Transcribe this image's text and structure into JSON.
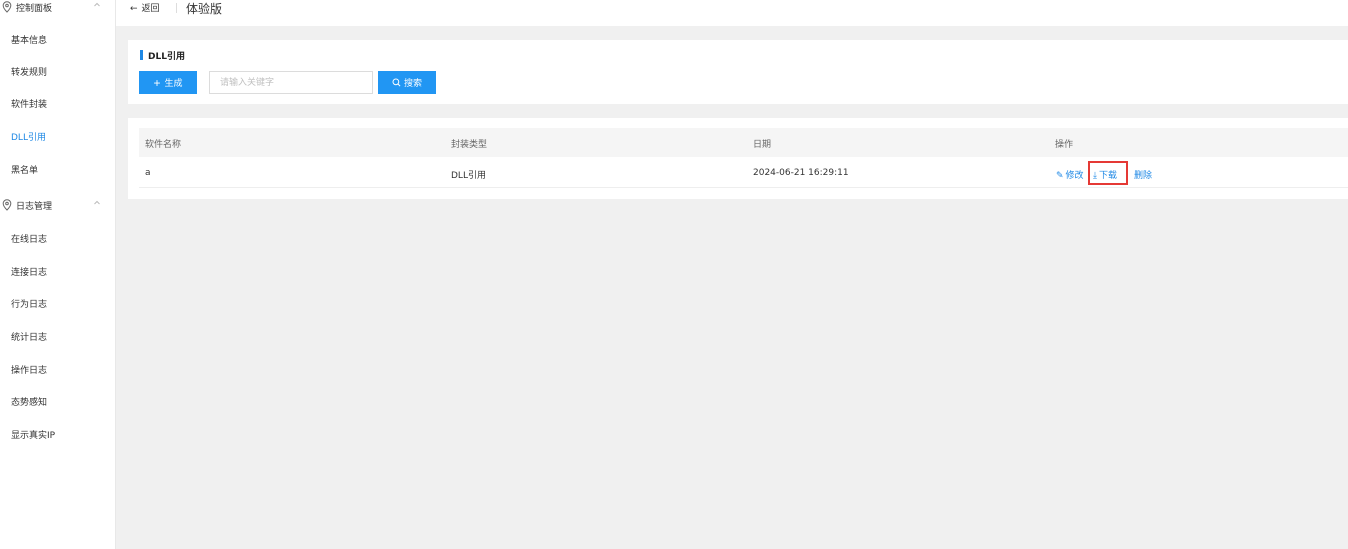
{
  "sidebar": {
    "group1": {
      "label": "控制面板"
    },
    "group1_items": [
      {
        "label": "基本信息"
      },
      {
        "label": "转发规则"
      },
      {
        "label": "软件封装"
      },
      {
        "label": "DLL引用"
      },
      {
        "label": "黑名单"
      }
    ],
    "group2": {
      "label": "日志管理"
    },
    "group2_items": [
      {
        "label": "在线日志"
      },
      {
        "label": "连接日志"
      },
      {
        "label": "行为日志"
      },
      {
        "label": "统计日志"
      },
      {
        "label": "操作日志"
      },
      {
        "label": "态势感知"
      },
      {
        "label": "显示真实IP"
      }
    ],
    "active_item": "DLL引用"
  },
  "header": {
    "back_label": "返回",
    "back_arrow": "←",
    "title": "体验版"
  },
  "search_panel": {
    "section_title": "DLL引用",
    "generate_label": "生成",
    "search_placeholder": "请输入关键字",
    "search_label": "搜索"
  },
  "table": {
    "columns": [
      "软件名称",
      "封装类型",
      "日期",
      "操作"
    ],
    "rows": [
      {
        "name": "a",
        "type": "DLL引用",
        "date": "2024-06-21 16:29:11",
        "actions": {
          "edit": "修改",
          "download": "下载",
          "delete": "删除"
        }
      }
    ]
  },
  "colors": {
    "accent": "#2196f3",
    "link": "#1e88e5",
    "highlight": "#e53935",
    "background": "#f0f0f0"
  }
}
